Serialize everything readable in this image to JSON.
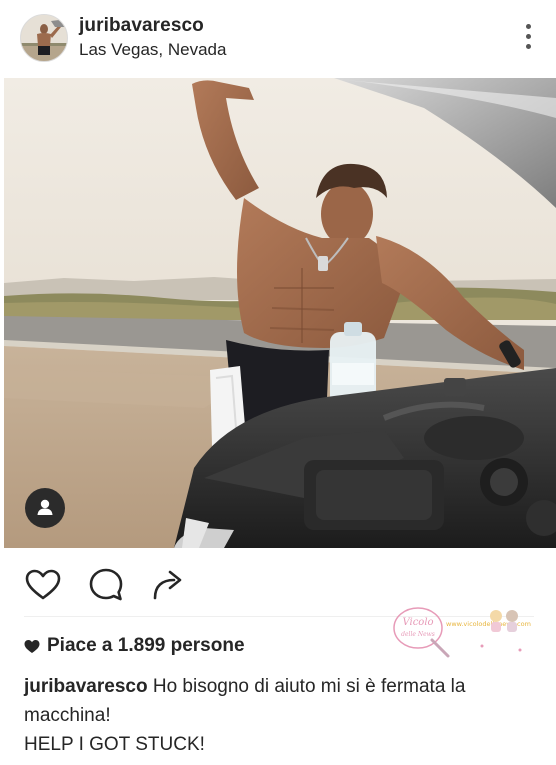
{
  "post": {
    "username": "juribavaresco",
    "location": "Las Vegas, Nevada",
    "avatar_icon": "profile-photo",
    "more_icon": "more-vertical-icon",
    "photo_alt": "photo",
    "tag_icon": "user-tag-icon"
  },
  "actions": {
    "like_icon": "heart-outline-icon",
    "comment_icon": "comment-bubble-icon",
    "share_icon": "share-arrow-icon"
  },
  "likes": {
    "icon": "heart-filled-icon",
    "text": "Piace a 1.899 persone"
  },
  "caption": {
    "username": "juribavaresco",
    "text_line1": " Ho bisogno di aiuto mi si è fermata la",
    "text_line2": "macchina!",
    "text_line3": "HELP I GOT STUCK!"
  },
  "watermark": {
    "logo_text": "Vicolo",
    "logo_subtext": "delle News",
    "side_text": "www.vicolodellenews.com"
  },
  "colors": {
    "text": "#262626",
    "icon": "#262626",
    "watermark_pink": "#e79bb8"
  }
}
